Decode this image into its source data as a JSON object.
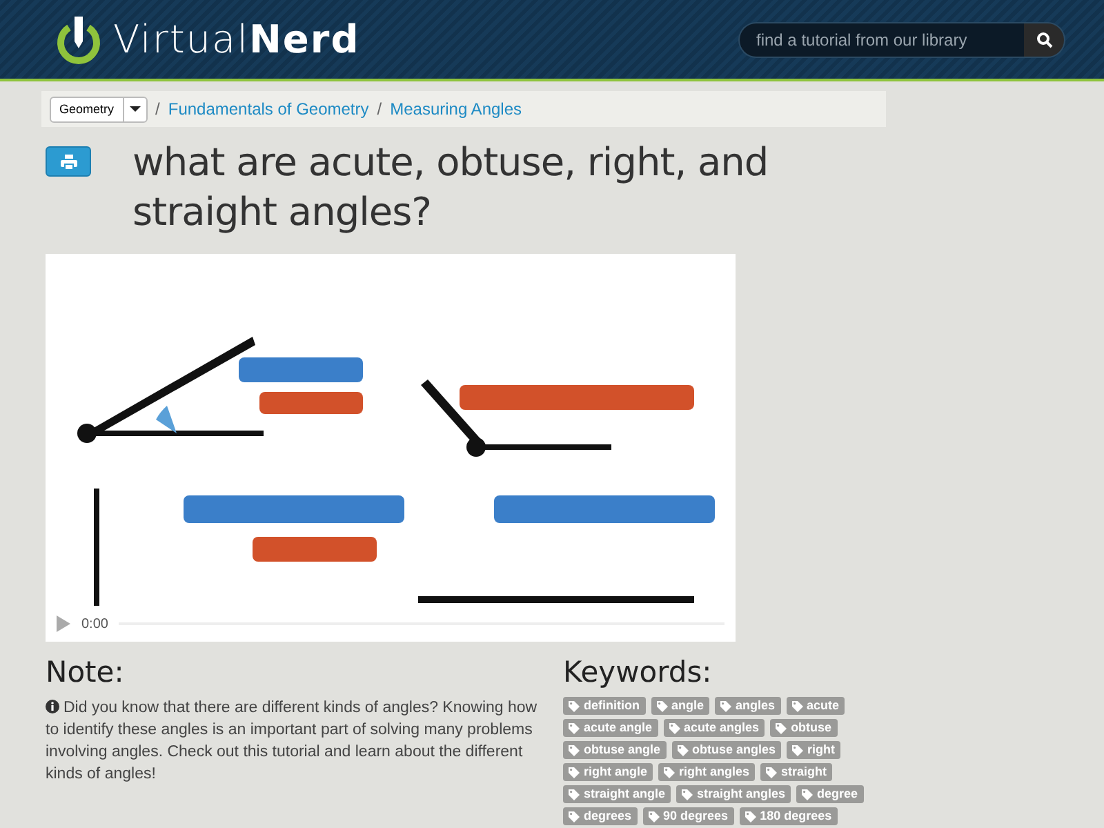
{
  "header": {
    "logo": "Virtual**Nerd**",
    "search": {
      "placeholder": "find a tutorial from our library"
    }
  },
  "breadcrumb": {
    "subject": "Geometry",
    "separator": "/",
    "links": [
      "Fundamentals of Geometry",
      "Measuring Angles"
    ]
  },
  "title": "what are acute, obtuse, right, and straight angles?",
  "video": {
    "kind": "picture",
    "time": "0:00"
  },
  "note": {
    "heading": "Note:",
    "text": "Did you know that there are different kinds of angles? Knowing how to identify these angles is an important part of solving many problems involving angles. Check out this tutorial and learn about the different kinds of angles!"
  },
  "keywords": {
    "heading": "Keywords:",
    "tags": [
      "definition",
      "angle",
      "angles",
      "acute",
      "acute angle",
      "acute angles",
      "obtuse",
      "obtuse angle",
      "obtuse angles",
      "right",
      "right angle",
      "right angles",
      "straight",
      "straight angle",
      "straight angles",
      "degree",
      "degrees",
      "90 degrees",
      "180 degrees"
    ]
  }
}
